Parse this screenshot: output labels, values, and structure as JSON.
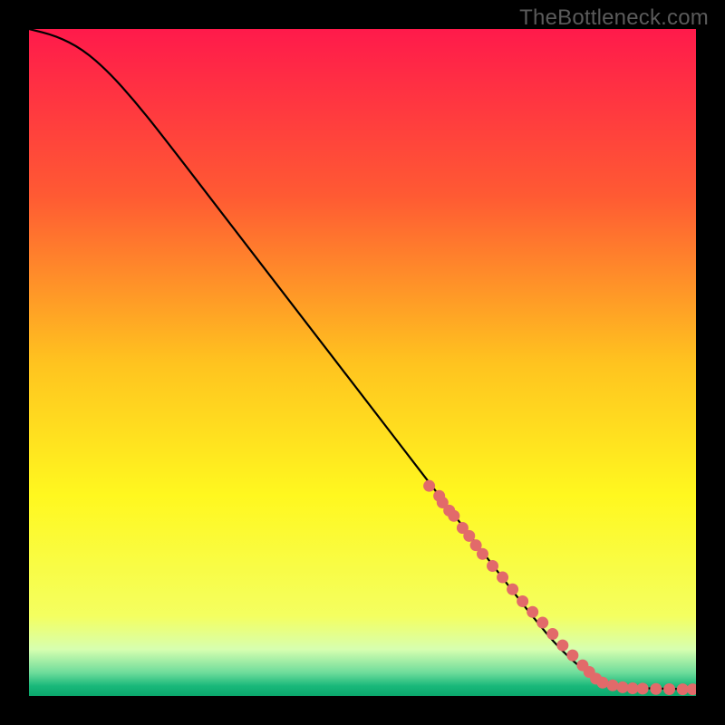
{
  "attribution": "TheBottleneck.com",
  "chart_data": {
    "type": "line",
    "title": "",
    "xlabel": "",
    "ylabel": "",
    "xlim": [
      0,
      100
    ],
    "ylim": [
      0,
      100
    ],
    "background_gradient": {
      "stops": [
        {
          "pos": 0.0,
          "color": "#ff1a4b"
        },
        {
          "pos": 0.25,
          "color": "#ff5a33"
        },
        {
          "pos": 0.5,
          "color": "#ffc31f"
        },
        {
          "pos": 0.7,
          "color": "#fff81f"
        },
        {
          "pos": 0.88,
          "color": "#f4ff60"
        },
        {
          "pos": 0.93,
          "color": "#d7ffb0"
        },
        {
          "pos": 0.965,
          "color": "#6edc9b"
        },
        {
          "pos": 0.985,
          "color": "#19b87a"
        },
        {
          "pos": 1.0,
          "color": "#0aa86c"
        }
      ]
    },
    "series": [
      {
        "name": "curve",
        "x": [
          0,
          4,
          8,
          12,
          16,
          20,
          30,
          40,
          50,
          60,
          65,
          70,
          75,
          80,
          85,
          90,
          95,
          100
        ],
        "y": [
          100,
          99,
          97,
          93.5,
          89,
          84,
          71,
          58,
          45,
          32,
          25.5,
          19,
          12.5,
          6.5,
          2.5,
          1.2,
          1.1,
          1.0
        ]
      }
    ],
    "scatter": {
      "name": "points",
      "color": "#e26a6a",
      "x": [
        60,
        61.5,
        62,
        63,
        63.7,
        65,
        66,
        67,
        68,
        69.5,
        71,
        72.5,
        74,
        75.5,
        77,
        78.5,
        80,
        81.5,
        83,
        84,
        85,
        86,
        87.5,
        89,
        90.5,
        92,
        94,
        96,
        98,
        99.5
      ],
      "y": [
        31.5,
        30,
        29,
        27.8,
        27,
        25.2,
        24,
        22.6,
        21.3,
        19.5,
        17.8,
        16,
        14.2,
        12.6,
        11,
        9.3,
        7.6,
        6.1,
        4.6,
        3.6,
        2.6,
        2,
        1.6,
        1.3,
        1.15,
        1.1,
        1.05,
        1.02,
        1.0,
        1.0
      ]
    }
  }
}
